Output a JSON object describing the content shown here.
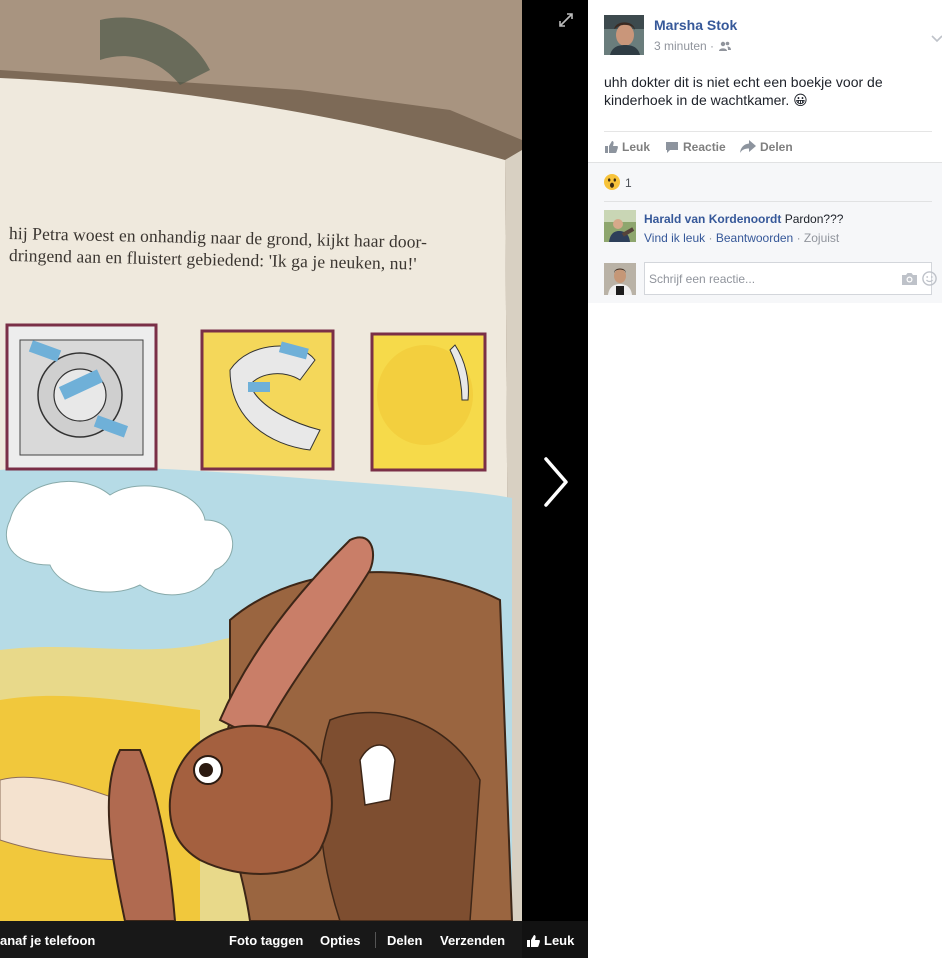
{
  "photo": {
    "page_text_line1": "hij Petra woest en onhandig naar de grond, kijkt haar door-",
    "page_text_line2": "dringend aan en fluistert gebiedend: 'Ik ga je neuken, nu!'"
  },
  "photo_bar": {
    "upload_label": "anaf je telefoon",
    "tag_label": "Foto taggen",
    "options_label": "Opties",
    "share_label": "Delen",
    "send_label": "Verzenden",
    "like_label": "Leuk"
  },
  "post": {
    "author": "Marsha Stok",
    "time": "3 minuten",
    "meta_separator": "·",
    "audience_icon": "friends-icon",
    "text": "uhh dokter dit is niet echt een boekje voor de kinderhoek in de wachtkamer. 😀"
  },
  "actions": {
    "like": "Leuk",
    "comment": "Reactie",
    "share": "Delen"
  },
  "reactions": {
    "type_icon": "wow-reaction-icon",
    "count": "1"
  },
  "comment": {
    "author": "Harald van Kordenoordt",
    "text": "Pardon???",
    "like_link": "Vind ik leuk",
    "reply_link": "Beantwoorden",
    "dot": "·",
    "time": "Zojuist"
  },
  "composer": {
    "placeholder": "Schrijf een reactie..."
  },
  "colors": {
    "link_blue": "#365899",
    "meta_grey": "#90949c",
    "comments_bg": "#f6f7f9"
  }
}
